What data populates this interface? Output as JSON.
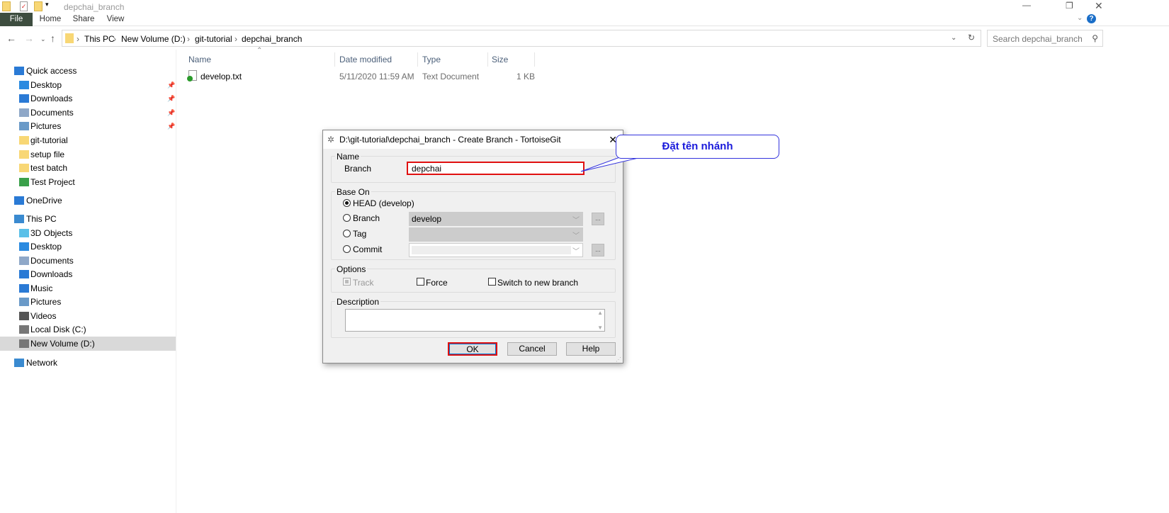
{
  "window": {
    "title": "depchai_branch"
  },
  "ribbon": {
    "tabs": [
      "File",
      "Home",
      "Share",
      "View"
    ]
  },
  "address": {
    "crumbs": [
      "This PC",
      "New Volume (D:)",
      "git-tutorial",
      "depchai_branch"
    ],
    "search_placeholder": "Search depchai_branch"
  },
  "sidebar": {
    "items": [
      {
        "label": "Quick access",
        "icon": "star-icon",
        "pinned": false
      },
      {
        "label": "Desktop",
        "icon": "desktop-icon",
        "pinned": true
      },
      {
        "label": "Downloads",
        "icon": "download-icon",
        "pinned": true
      },
      {
        "label": "Documents",
        "icon": "documents-icon",
        "pinned": true
      },
      {
        "label": "Pictures",
        "icon": "pictures-icon",
        "pinned": true
      },
      {
        "label": "git-tutorial",
        "icon": "folder-icon",
        "pinned": false
      },
      {
        "label": "setup file",
        "icon": "folder-icon",
        "pinned": false
      },
      {
        "label": "test batch",
        "icon": "folder-icon",
        "pinned": false
      },
      {
        "label": "Test Project",
        "icon": "git-folder-icon",
        "pinned": false
      },
      {
        "label": "OneDrive",
        "icon": "cloud-icon",
        "pinned": false
      },
      {
        "label": "This PC",
        "icon": "computer-icon",
        "pinned": false
      },
      {
        "label": "3D Objects",
        "icon": "cube-icon",
        "pinned": false
      },
      {
        "label": "Desktop",
        "icon": "desktop-icon",
        "pinned": false
      },
      {
        "label": "Documents",
        "icon": "documents-icon",
        "pinned": false
      },
      {
        "label": "Downloads",
        "icon": "download-icon",
        "pinned": false
      },
      {
        "label": "Music",
        "icon": "music-icon",
        "pinned": false
      },
      {
        "label": "Pictures",
        "icon": "pictures-icon",
        "pinned": false
      },
      {
        "label": "Videos",
        "icon": "videos-icon",
        "pinned": false
      },
      {
        "label": "Local Disk (C:)",
        "icon": "drive-icon",
        "pinned": false
      },
      {
        "label": "New Volume (D:)",
        "icon": "drive-icon",
        "pinned": false,
        "selected": true
      },
      {
        "label": "Network",
        "icon": "network-icon",
        "pinned": false
      }
    ]
  },
  "files": {
    "columns": [
      "Name",
      "Date modified",
      "Type",
      "Size"
    ],
    "rows": [
      {
        "name": "develop.txt",
        "date": "5/11/2020 11:59 AM",
        "type": "Text Document",
        "size": "1 KB"
      }
    ]
  },
  "dialog": {
    "title": "D:\\git-tutorial\\depchai_branch - Create Branch - TortoiseGit",
    "name_group": "Name",
    "branch_label": "Branch",
    "branch_value": "depchai",
    "base_group": "Base On",
    "head_label": "HEAD (develop)",
    "branch_radio": "Branch",
    "branch_combo": "develop",
    "tag_radio": "Tag",
    "commit_radio": "Commit",
    "dots": "...",
    "options_group": "Options",
    "track": "Track",
    "force": "Force",
    "switch": "Switch to new branch",
    "description_group": "Description",
    "ok": "OK",
    "cancel": "Cancel",
    "help": "Help"
  },
  "callout": {
    "text": "Đặt tên nhánh",
    "color": "#1a1adb"
  }
}
